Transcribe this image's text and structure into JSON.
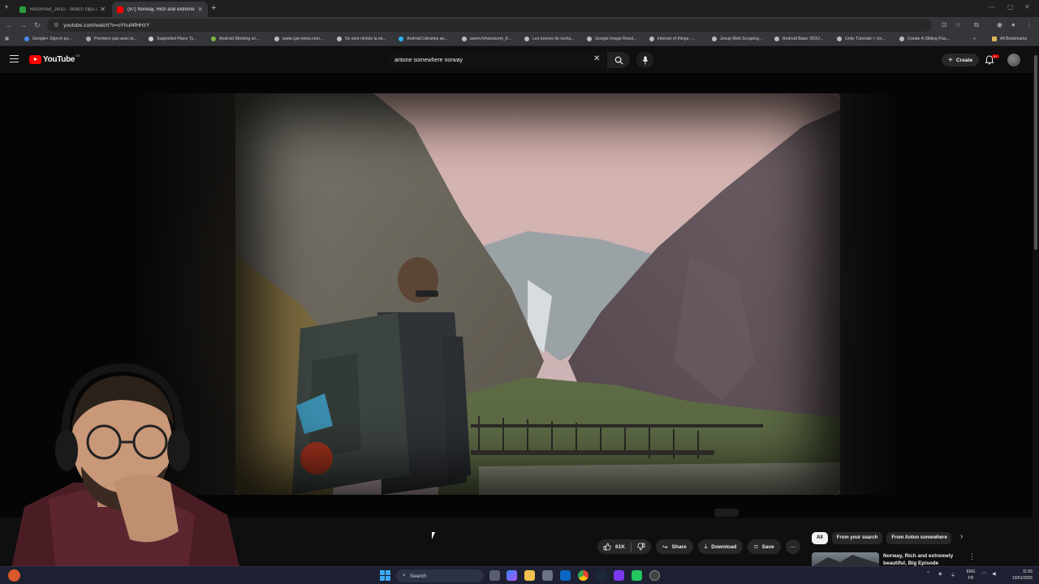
{
  "browser": {
    "tabs": [
      {
        "title": "Reformed_Jinzu - Watch clips o",
        "color": "#2a9d3c"
      },
      {
        "title": "(97) Norway, Rich and extreme",
        "color": "#ff0000"
      }
    ],
    "url": "youtube.com/watch?v=oYhuf4fHHzY",
    "bookmarks": [
      "Google+ Sign-in po...",
      "Premiers pas avec la...",
      "Supported Place Ty...",
      "Android Working wi...",
      "www.cge-news.com...",
      "Se sont nichés la str...",
      "Android Libraries an...",
      "avem.fr/nss/avem_fl...",
      "Les bornes de recha...",
      "Google Image Resul...",
      "internet of things -...",
      "Jsoup Web Scraping...",
      "Android Basic ISOU...",
      "Unity Tutorials > Un...",
      "Create A Sliding Pau..."
    ],
    "all_bookmarks": "All Bookmarks"
  },
  "youtube": {
    "logo": "YouTube",
    "country_code": "DE",
    "search_query": "antone somewhere norway",
    "create_label": "Create",
    "notification_badge": "9+"
  },
  "actions": {
    "likes": "61K",
    "share": "Share",
    "download": "Download",
    "save": "Save"
  },
  "chips": [
    "All",
    "From your search",
    "From Anton somewhere"
  ],
  "recommendation": {
    "title": "Norway, Rich and extremely beautiful, Big Episode"
  },
  "taskbar": {
    "search_placeholder": "Search",
    "lang_line1": "ENG",
    "lang_line2": "FR",
    "time": "11:56",
    "date": "10/01/2026"
  },
  "colors": {
    "yt_red": "#ff0000",
    "bg": "#0f0f0f",
    "pill": "#272727"
  }
}
